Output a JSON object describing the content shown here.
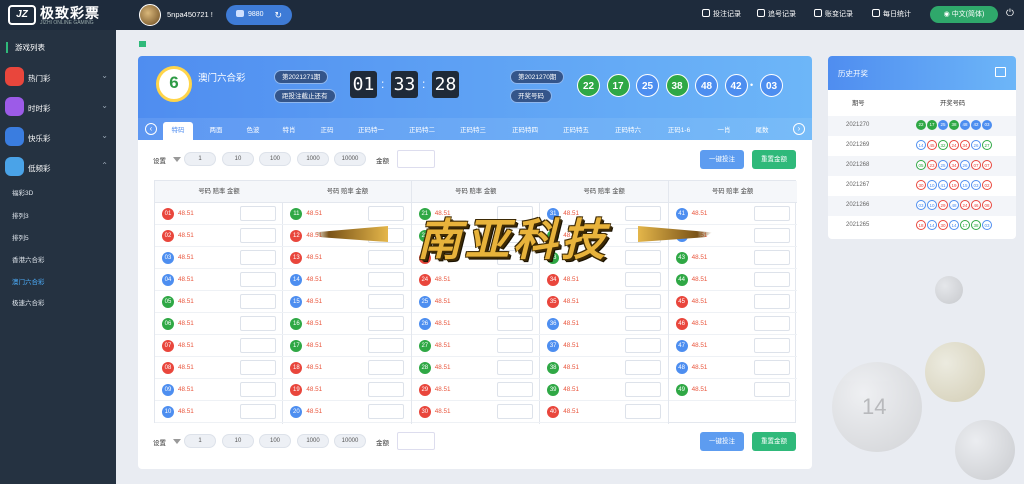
{
  "header": {
    "logo_text": "极致彩票",
    "logo_sub": "JIZHI ONLINE GAMING",
    "username": "5npa450721 !",
    "balance": "9880",
    "nav": [
      "投注记录",
      "追号记录",
      "账变记录",
      "每日统计"
    ],
    "language": "中文(简体)"
  },
  "sidebar": {
    "title": "游戏列表",
    "categories": [
      {
        "label": "热门彩",
        "icon": "hot-lottery-icon",
        "color": "#e9463c"
      },
      {
        "label": "时时彩",
        "icon": "ssc-icon",
        "color": "#9c5be8"
      },
      {
        "label": "快乐彩",
        "icon": "happy-lottery-icon",
        "color": "#3a7de0"
      },
      {
        "label": "低频彩",
        "icon": "low-freq-icon",
        "color": "#4aa3e8"
      }
    ],
    "subitems": [
      "福彩3D",
      "排列3",
      "排列5",
      "香港六合彩",
      "澳门六合彩",
      "极速六合彩"
    ],
    "active_sub": 4
  },
  "game": {
    "name": "澳门六合彩",
    "logo_number": "6",
    "current_period": "第2021271期",
    "deadline_label": "距投注截止还有",
    "countdown": [
      "01",
      "33",
      "28"
    ],
    "last_period": "第2021270期",
    "draw_label": "开奖号码",
    "draw_numbers": [
      {
        "n": "22",
        "c": "green"
      },
      {
        "n": "17",
        "c": "green"
      },
      {
        "n": "25",
        "c": "blue"
      },
      {
        "n": "38",
        "c": "green"
      },
      {
        "n": "48",
        "c": "blue"
      },
      {
        "n": "42",
        "c": "blue"
      },
      {
        "n": "03",
        "c": "blue"
      }
    ]
  },
  "tabs": [
    "特码",
    "两面",
    "色波",
    "特肖",
    "正码",
    "正码特一",
    "正码特二",
    "正码特三",
    "正码特四",
    "正码特五",
    "正码特六",
    "正码1-6",
    "一肖",
    "尾数"
  ],
  "settings": {
    "label": "设置",
    "chips": [
      "1",
      "10",
      "100",
      "1000",
      "10000"
    ],
    "amount_label": "金额",
    "bet_button": "一键投注",
    "reset_button": "重置金额"
  },
  "table": {
    "header": "号码  赔率  金额",
    "odds": "48.51",
    "columns": [
      [
        {
          "n": "01",
          "c": "red"
        },
        {
          "n": "02",
          "c": "red"
        },
        {
          "n": "03",
          "c": "blue"
        },
        {
          "n": "04",
          "c": "blue"
        },
        {
          "n": "05",
          "c": "green"
        },
        {
          "n": "06",
          "c": "green"
        },
        {
          "n": "07",
          "c": "red"
        },
        {
          "n": "08",
          "c": "red"
        },
        {
          "n": "09",
          "c": "blue"
        },
        {
          "n": "10",
          "c": "blue"
        }
      ],
      [
        {
          "n": "11",
          "c": "green"
        },
        {
          "n": "12",
          "c": "red"
        },
        {
          "n": "13",
          "c": "red"
        },
        {
          "n": "14",
          "c": "blue"
        },
        {
          "n": "15",
          "c": "blue"
        },
        {
          "n": "16",
          "c": "green"
        },
        {
          "n": "17",
          "c": "green"
        },
        {
          "n": "18",
          "c": "red"
        },
        {
          "n": "19",
          "c": "red"
        },
        {
          "n": "20",
          "c": "blue"
        }
      ],
      [
        {
          "n": "21",
          "c": "green"
        },
        {
          "n": "22",
          "c": "green"
        },
        {
          "n": "23",
          "c": "red"
        },
        {
          "n": "24",
          "c": "red"
        },
        {
          "n": "25",
          "c": "blue"
        },
        {
          "n": "26",
          "c": "blue"
        },
        {
          "n": "27",
          "c": "green"
        },
        {
          "n": "28",
          "c": "green"
        },
        {
          "n": "29",
          "c": "red"
        },
        {
          "n": "30",
          "c": "red"
        }
      ],
      [
        {
          "n": "31",
          "c": "blue"
        },
        {
          "n": "32",
          "c": "green"
        },
        {
          "n": "33",
          "c": "green"
        },
        {
          "n": "34",
          "c": "red"
        },
        {
          "n": "35",
          "c": "red"
        },
        {
          "n": "36",
          "c": "blue"
        },
        {
          "n": "37",
          "c": "blue"
        },
        {
          "n": "38",
          "c": "green"
        },
        {
          "n": "39",
          "c": "green"
        },
        {
          "n": "40",
          "c": "red"
        }
      ],
      [
        {
          "n": "41",
          "c": "blue"
        },
        {
          "n": "42",
          "c": "blue"
        },
        {
          "n": "43",
          "c": "green"
        },
        {
          "n": "44",
          "c": "green"
        },
        {
          "n": "45",
          "c": "red"
        },
        {
          "n": "46",
          "c": "red"
        },
        {
          "n": "47",
          "c": "blue"
        },
        {
          "n": "48",
          "c": "blue"
        },
        {
          "n": "49",
          "c": "green"
        }
      ]
    ]
  },
  "watermark": "南亚科技",
  "history": {
    "title": "历史开奖",
    "col_period": "期号",
    "col_numbers": "开奖号码",
    "rows": [
      {
        "period": "2021270",
        "numbers": [
          "22",
          "17",
          "25",
          "38",
          "48",
          "42",
          "03"
        ],
        "filled": true
      },
      {
        "period": "2021269",
        "numbers": [
          "14",
          "45",
          "32",
          "24",
          "34",
          "26",
          "27"
        ],
        "filled": false
      },
      {
        "period": "2021268",
        "numbers": [
          "05",
          "23",
          "25",
          "34",
          "26",
          "07",
          "07"
        ],
        "filled": false
      },
      {
        "period": "2021267",
        "numbers": [
          "30",
          "10",
          "41",
          "19",
          "15",
          "03",
          "02"
        ],
        "filled": false
      },
      {
        "period": "2021266",
        "numbers": [
          "03",
          "10",
          "29",
          "48",
          "24",
          "46",
          "08"
        ],
        "filled": false
      },
      {
        "period": "2021265",
        "numbers": [
          "18",
          "14",
          "30",
          "14",
          "17",
          "38",
          "03"
        ],
        "filled": false
      }
    ]
  },
  "colors": {
    "red": "#e9463c",
    "blue": "#4d8ef0",
    "green": "#2fa845",
    "accent": "#4f8df0"
  }
}
